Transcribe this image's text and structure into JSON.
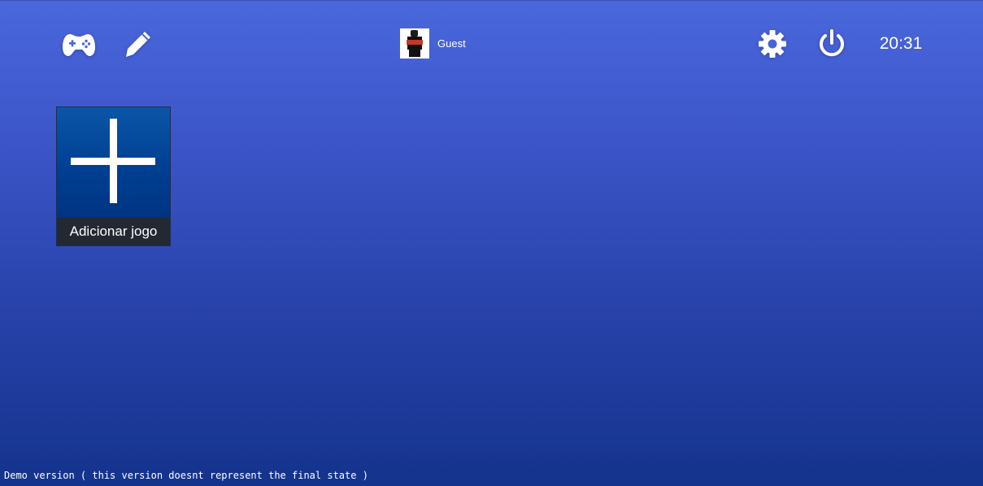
{
  "toolbar": {
    "left_icons": [
      "gamepad-icon",
      "pencil-icon"
    ],
    "right_icons": [
      "gear-icon",
      "power-icon"
    ],
    "clock": "20:31"
  },
  "user": {
    "name": "Guest"
  },
  "tiles": [
    {
      "label": "Adicionar jogo",
      "icon": "plus-icon"
    }
  ],
  "footer": {
    "notice": "Demo version ( this version doesnt represent the final state )"
  },
  "colors": {
    "background_top": "#4a67dc",
    "background_bottom": "#14338c",
    "tile": "#003f92",
    "tile_label_bg": "#232833",
    "text": "#ffffff"
  }
}
